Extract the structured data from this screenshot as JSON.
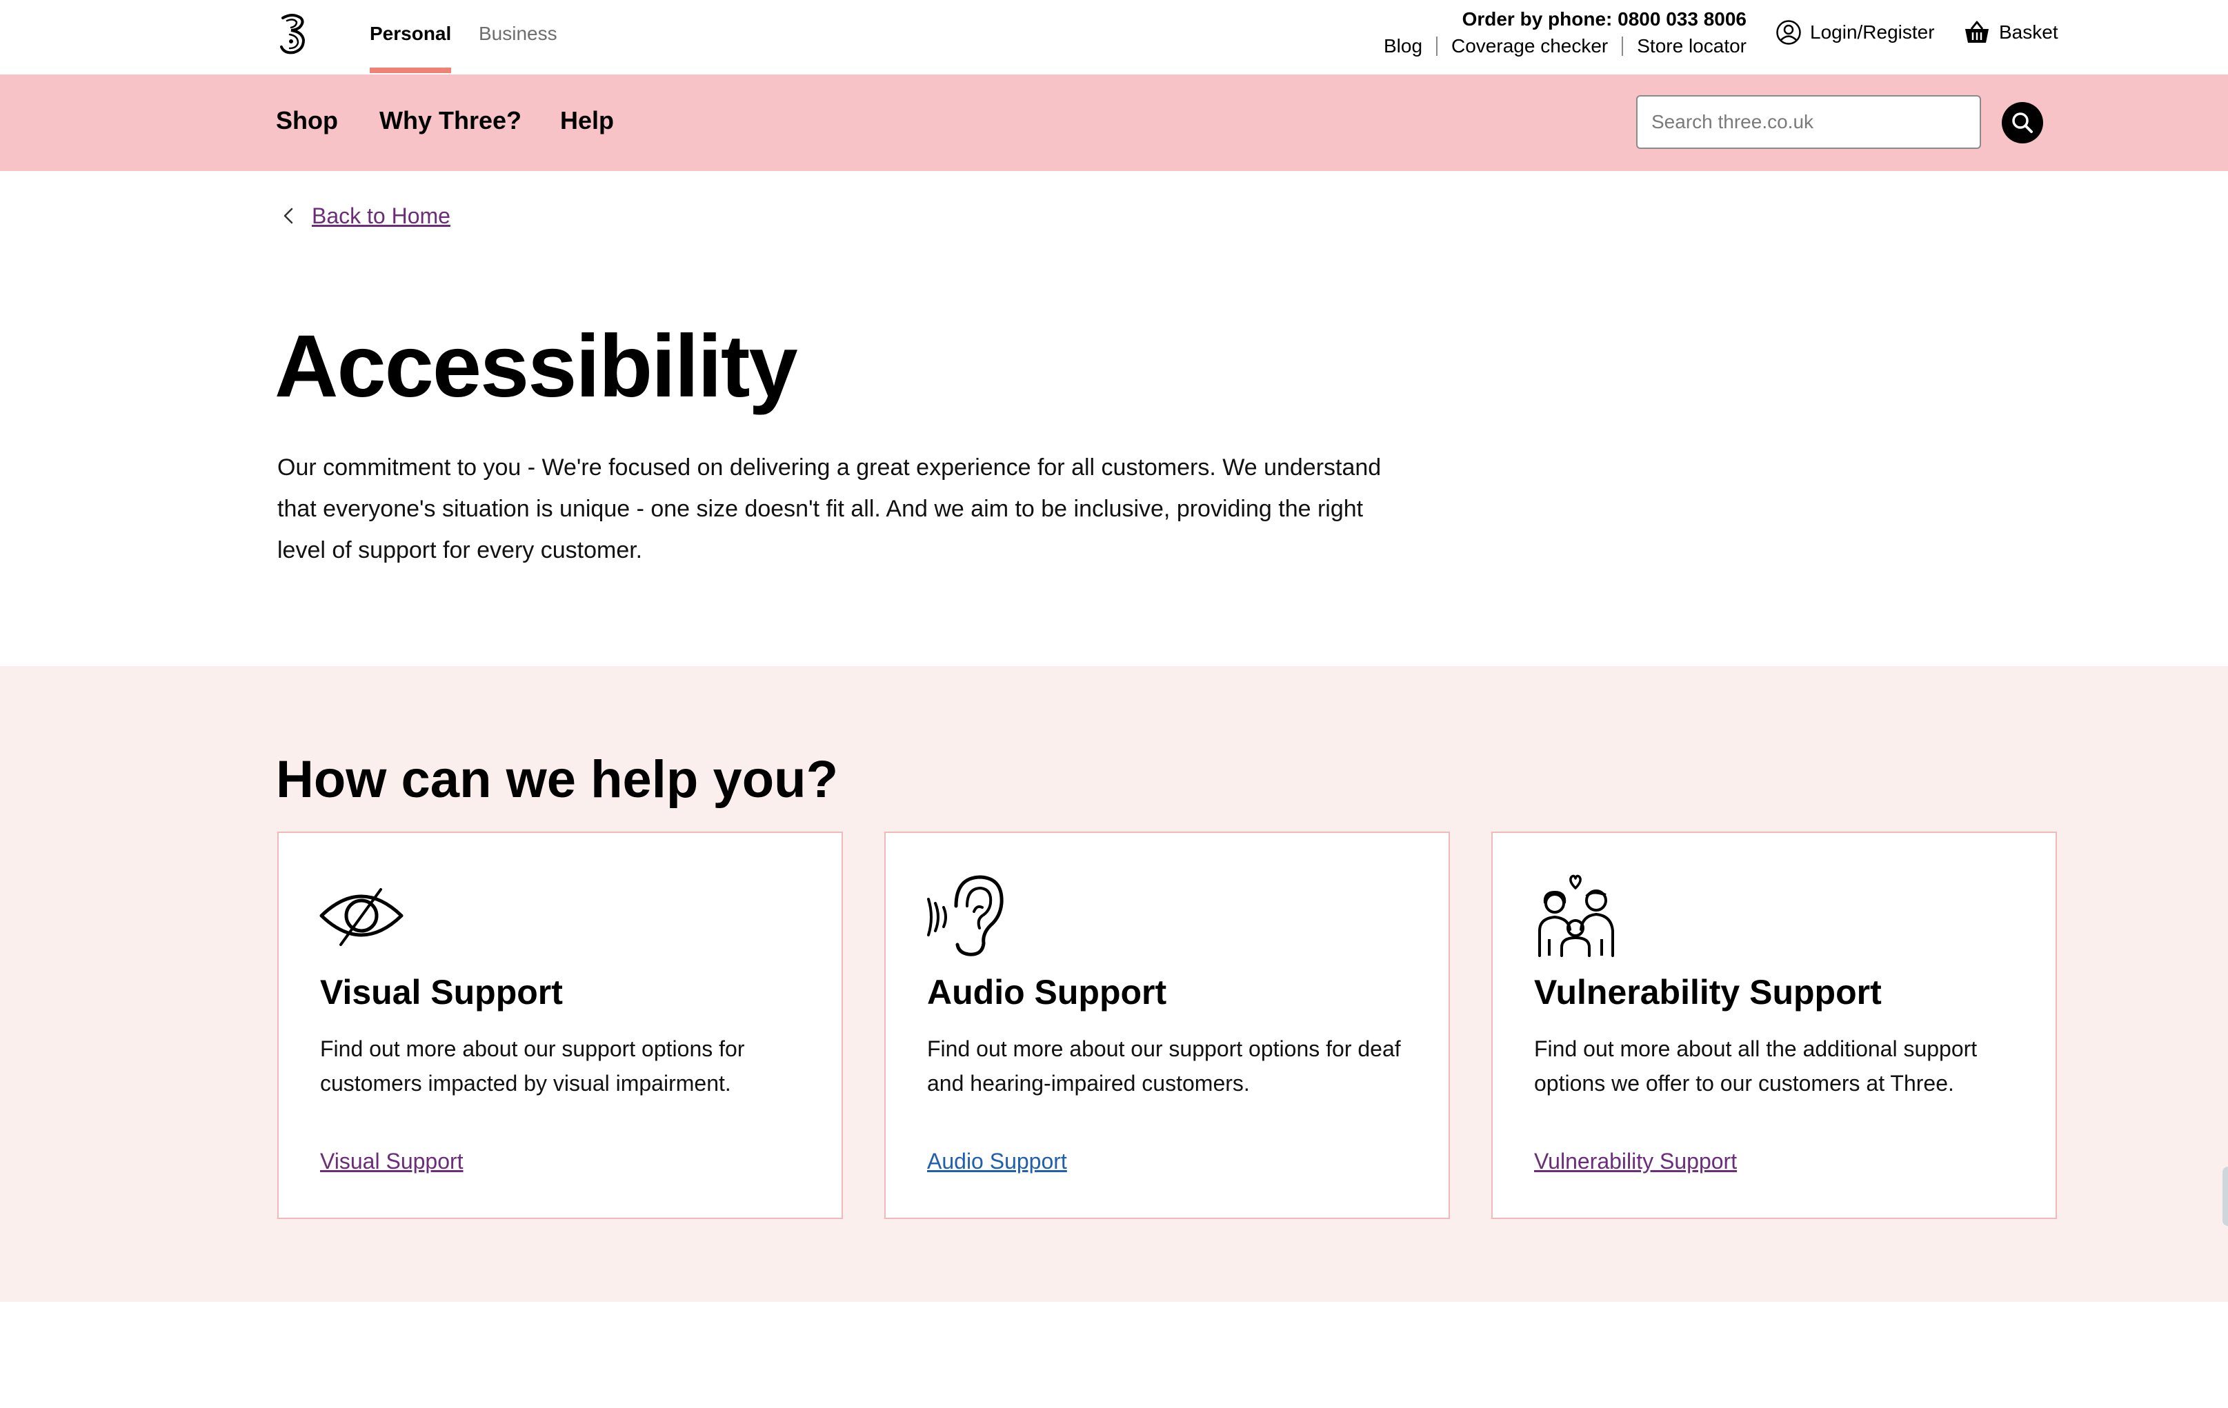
{
  "header": {
    "logo_icon": "three-logo-icon",
    "tabs": [
      {
        "label": "Personal",
        "active": true
      },
      {
        "label": "Business",
        "active": false
      }
    ],
    "order_phone": "Order by phone: 0800 033 8006",
    "utility_links": [
      "Blog",
      "Coverage checker",
      "Store locator"
    ],
    "login_label": "Login/Register",
    "basket_label": "Basket",
    "accent_color": "#f08275"
  },
  "nav": {
    "background_color": "#f7c3c6",
    "items": [
      "Shop",
      "Why Three?",
      "Help"
    ],
    "search_placeholder": "Search three.co.uk"
  },
  "hero": {
    "back_link": "Back to Home",
    "title": "Accessibility",
    "intro": "Our commitment to you - We're focused on delivering a great experience for all customers. We understand that everyone's situation is unique - one size doesn't fit all. And we aim to be inclusive, providing the right level of support for every customer."
  },
  "help": {
    "background_color": "#fbefed",
    "title": "How can we help you?",
    "cards": [
      {
        "icon": "eye-slash-icon",
        "title": "Visual Support",
        "text": "Find out more about our support options for customers impacted by visual impairment.",
        "link": "Visual Support"
      },
      {
        "icon": "ear-icon",
        "title": "Audio Support",
        "text": "Find out more about our support options for deaf and hearing-impaired customers.",
        "link": "Audio Support"
      },
      {
        "icon": "family-icon",
        "title": "Vulnerability Support",
        "text": "Find out more about all the additional support options we offer to our customers at Three.",
        "link": "Vulnerability Support"
      }
    ]
  }
}
